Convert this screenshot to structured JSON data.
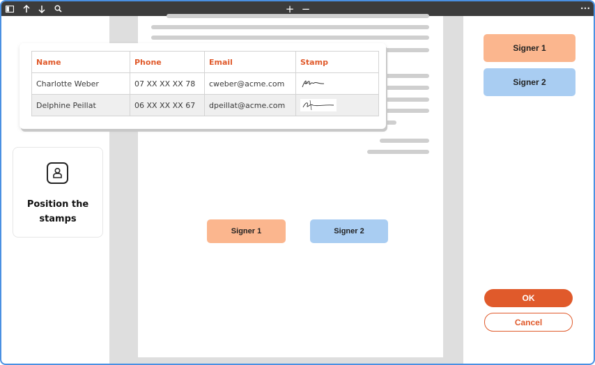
{
  "toolbar": {
    "icons": [
      "sidebar-toggle-icon",
      "arrow-up-icon",
      "arrow-down-icon",
      "search-icon",
      "zoom-in-icon",
      "zoom-out-icon",
      "more-icon"
    ],
    "zoom_in": "+",
    "zoom_out": "−",
    "more": "•••"
  },
  "table": {
    "headers": [
      "Name",
      "Phone",
      "Email",
      "Stamp"
    ],
    "rows": [
      {
        "name": "Charlotte Weber",
        "phone": "07 XX XX XX 78",
        "email": "cweber@acme.com"
      },
      {
        "name": "Delphine Peillat",
        "phone": "06 XX XX XX 67",
        "email": "dpeillat@acme.com"
      }
    ]
  },
  "side_card": {
    "icon": "stamp-person-icon",
    "label": "Position the\nstamps"
  },
  "document": {
    "signer1_label": "Signer 1",
    "signer2_label": "Signer 2"
  },
  "right_panel": {
    "signer1_label": "Signer 1",
    "signer2_label": "Signer 2",
    "ok_label": "OK",
    "cancel_label": "Cancel"
  },
  "colors": {
    "accent": "#e05a2b",
    "signer1": "#fbb68e",
    "signer2": "#a9cdf2",
    "frame_border": "#4a90e2",
    "toolbar": "#3c3c3c"
  }
}
